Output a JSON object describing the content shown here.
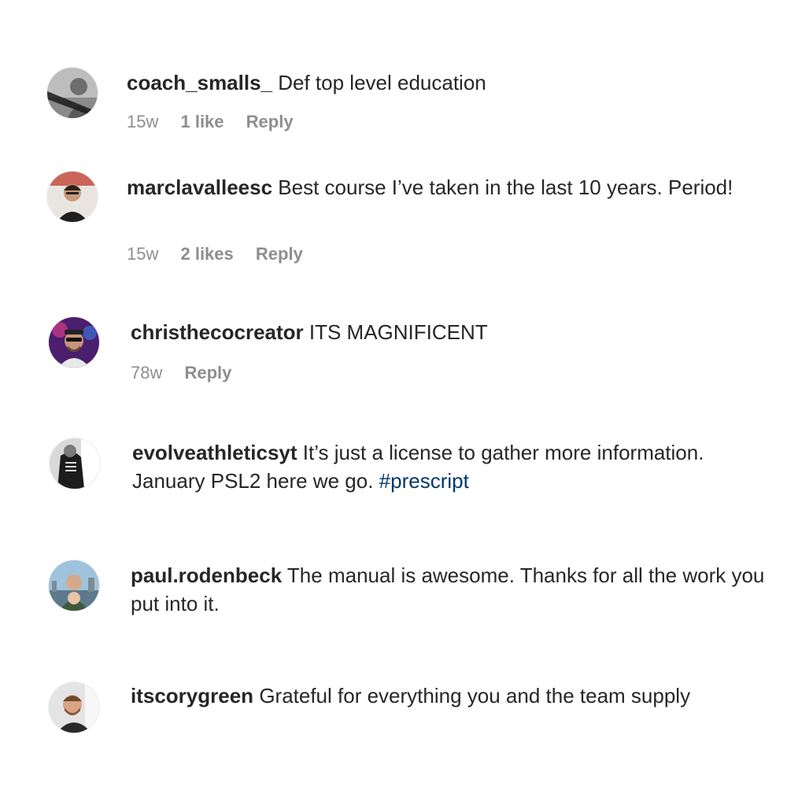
{
  "comments": [
    {
      "username": "coach_smalls_",
      "text": "Def top level education",
      "time": "15w",
      "likes": "1 like",
      "reply": "Reply"
    },
    {
      "username": "marclavalleesc",
      "text": "Best course I’ve taken in the last 10 years. Period!",
      "time": "15w",
      "likes": "2 likes",
      "reply": "Reply"
    },
    {
      "username": "christhecocreator",
      "text": "ITS MAGNIFICENT",
      "time": "78w",
      "reply": "Reply"
    },
    {
      "username": "evolveathleticsyt",
      "text": "It’s just a license to gather more information. January PSL2 here we go.",
      "hashtag": "#prescript"
    },
    {
      "username": "paul.rodenbeck",
      "text": "The manual is awesome. Thanks for all the work you put into it."
    },
    {
      "username": "itscorygreen",
      "text": "Grateful for everything you and the team supply"
    }
  ],
  "colors": {
    "text": "#262626",
    "meta": "#8e8e8e",
    "hashtag": "#00376b"
  }
}
